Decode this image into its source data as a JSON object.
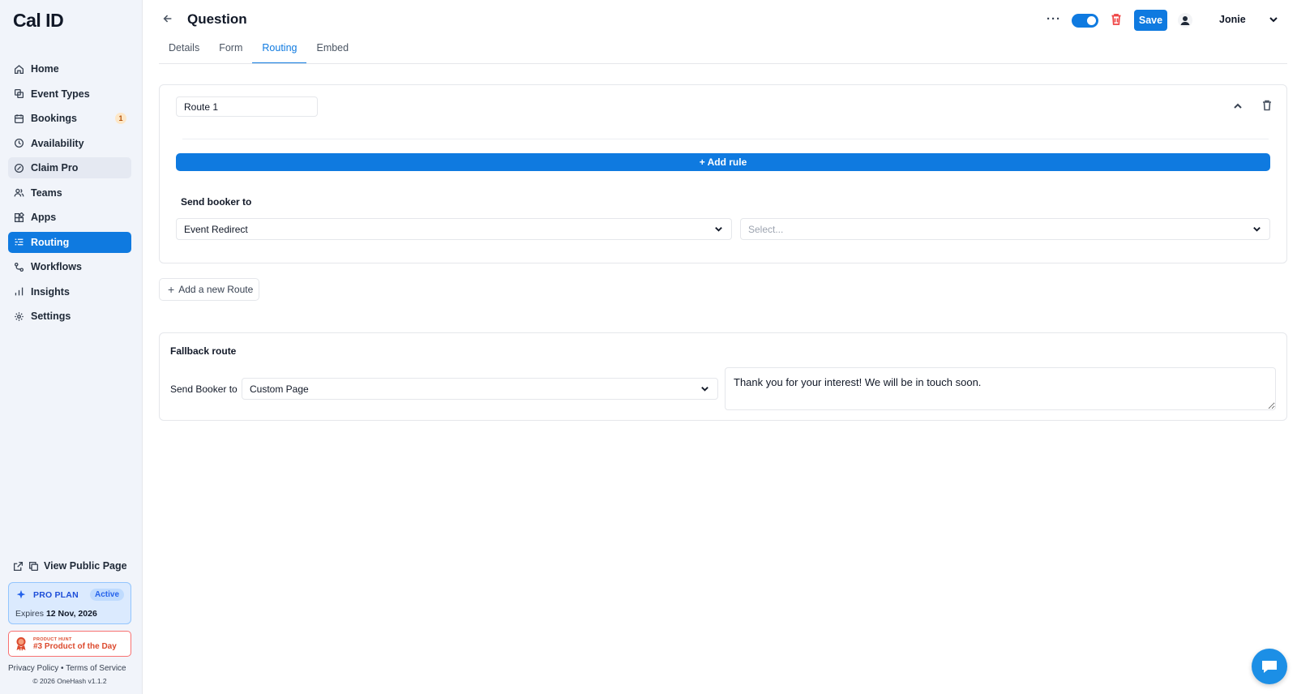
{
  "brand": {
    "logo": "Cal ID"
  },
  "sidebar": {
    "items": [
      {
        "label": "Home",
        "icon": "home-icon"
      },
      {
        "label": "Event Types",
        "icon": "link-icon"
      },
      {
        "label": "Bookings",
        "icon": "calendar-icon",
        "badge": "1"
      },
      {
        "label": "Availability",
        "icon": "clock-icon"
      },
      {
        "label": "Claim Pro",
        "icon": "badge-icon"
      },
      {
        "label": "Teams",
        "icon": "users-icon"
      },
      {
        "label": "Apps",
        "icon": "grid-icon"
      },
      {
        "label": "Routing",
        "icon": "routing-icon",
        "active": true
      },
      {
        "label": "Workflows",
        "icon": "workflow-icon"
      },
      {
        "label": "Insights",
        "icon": "bar-chart-icon"
      },
      {
        "label": "Settings",
        "icon": "gear-icon"
      }
    ],
    "view_public_page": "View Public Page",
    "pro_plan": {
      "label": "PRO PLAN",
      "status": "Active",
      "expires_prefix": "Expires",
      "expires_date": "12 Nov, 2026"
    },
    "product_hunt": {
      "small": "PRODUCT HUNT",
      "big": "#3 Product of the Day"
    },
    "footer": {
      "privacy": "Privacy Policy",
      "separator": "•",
      "terms": "Terms of Service",
      "copyright": "© 2026 OneHash v1.1.2"
    }
  },
  "header": {
    "title": "Question",
    "tabs": [
      {
        "label": "Details"
      },
      {
        "label": "Form"
      },
      {
        "label": "Routing",
        "active": true
      },
      {
        "label": "Embed"
      }
    ],
    "more": "···",
    "save_label": "Save",
    "user_name": "Jonie"
  },
  "route": {
    "name": "Route 1",
    "add_rule": "+ Add rule",
    "send_label": "Send booker to",
    "type_value": "Event Redirect",
    "target_placeholder": "Select..."
  },
  "add_route": {
    "label": "Add a new Route"
  },
  "fallback": {
    "title": "Fallback route",
    "send_label": "Send Booker to",
    "type_value": "Custom Page",
    "message": "Thank you for your interest! We will be in touch soon."
  },
  "colors": {
    "accent": "#0f7ae0",
    "danger": "#ef4444",
    "sidebar_bg": "#f1f4fa"
  }
}
